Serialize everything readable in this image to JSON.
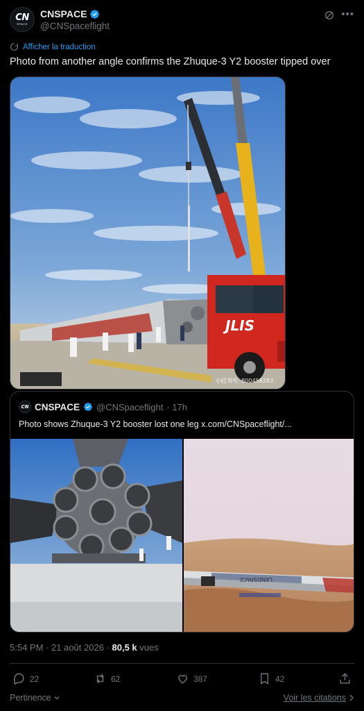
{
  "author": {
    "display_name": "CNSPACE",
    "handle": "@CNSpaceflight",
    "avatar_text": "CN",
    "avatar_subtext": "SPACE"
  },
  "translate": {
    "label": "Afficher la traduction"
  },
  "tweet": {
    "text": "Photo from another angle confirms the Zhuque-3 Y2 booster tipped over",
    "image_watermark": "小红书号: 800458283",
    "truck_logo": "JLIS"
  },
  "quote": {
    "display_name": "CNSPACE",
    "handle": "@CNSpaceflight",
    "time": "· 17h",
    "text": "Photo shows Zhuque-3 Y2 booster lost one leg",
    "link": "x.com/CNSpaceflight/...",
    "avatar_text": "CN",
    "stage_lettering": "LANDSPACE"
  },
  "meta": {
    "time": "5:54 PM",
    "sep": "·",
    "date": "21 août 2026",
    "views_count": "80,5 k",
    "views_label": "vues"
  },
  "actions": {
    "replies": "22",
    "reposts": "62",
    "likes": "387",
    "bookmarks": "42"
  },
  "bottom": {
    "sort_label": "Pertinence",
    "quotes_label": "Voir les citations"
  },
  "colors": {
    "background": "#000000",
    "text": "#e7e9ea",
    "muted": "#71767b",
    "accent": "#1d9bf0",
    "border": "#2f3336"
  },
  "icons": [
    "verified-badge-icon",
    "grok-icon",
    "more-icon",
    "translate-icon",
    "reply-icon",
    "repost-icon",
    "like-icon",
    "bookmark-icon",
    "share-icon",
    "chevron-down-icon",
    "chevron-right-icon"
  ]
}
